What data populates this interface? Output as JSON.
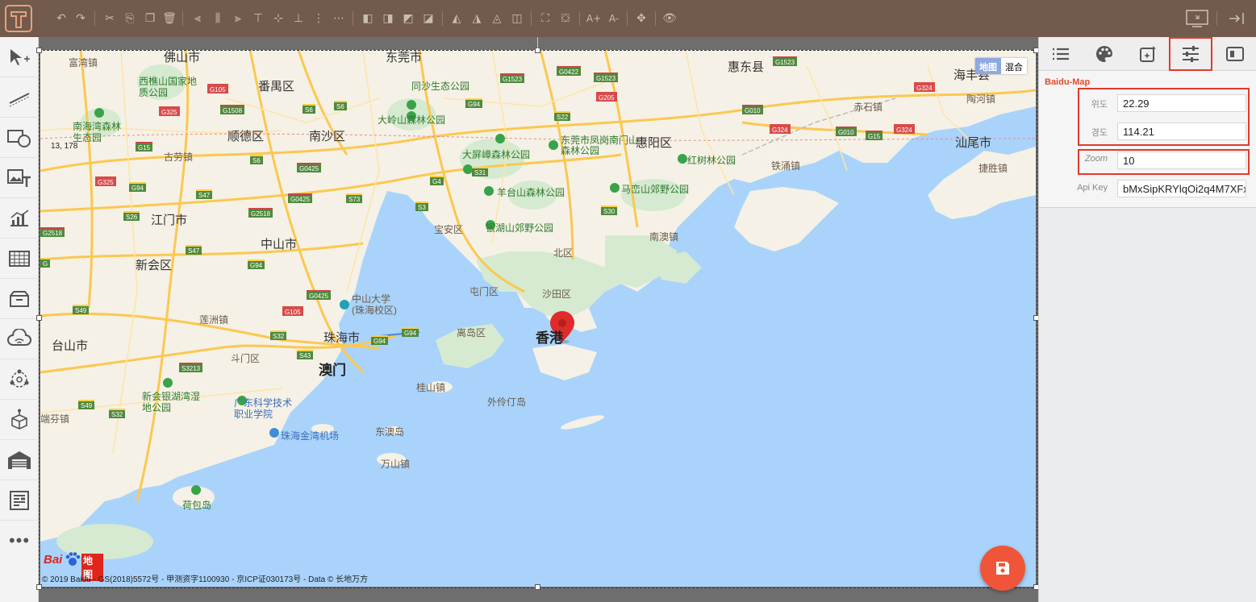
{
  "toolbar": {
    "logo": "T",
    "buttons": [
      "undo-icon",
      "redo-icon",
      "cut-icon",
      "copy-icon",
      "paste-icon",
      "delete-icon",
      "align-left-icon",
      "align-center-icon",
      "align-right-icon",
      "align-top-icon",
      "align-middle-icon",
      "align-bottom-icon",
      "distribute-h-icon",
      "distribute-v-icon",
      "bring-front-icon",
      "send-back-icon",
      "bring-forward-icon",
      "send-backward-icon",
      "flip-h-icon",
      "flip-v-icon",
      "rotate-left-icon",
      "rotate-right-icon",
      "group-icon",
      "ungroup-icon",
      "font-increase-icon",
      "font-decrease-icon",
      "move-icon",
      "preview-icon"
    ],
    "font_up": "A+",
    "font_down": "A-"
  },
  "leftbar": {
    "items": [
      "pointer-tool-icon",
      "line-tool-icon",
      "shape-tool-icon",
      "image-text-tool-icon",
      "chart-tool-icon",
      "table-tool-icon",
      "container-tool-icon",
      "cloud-wifi-tool-icon",
      "network-tool-icon",
      "3d-box-tool-icon",
      "warehouse-tool-icon",
      "form-tool-icon"
    ],
    "more_label": "•••"
  },
  "map": {
    "type_buttons": {
      "map": "地图",
      "hybrid": "混合"
    },
    "cursor_coords": "13, 178",
    "copyright": "© 2019 Baidu - GS(2018)5572号 - 甲测资字1100930 - 京ICP证030173号 - Data © 长地万方",
    "logo_text": "Bai",
    "logo_text2": "地图",
    "labels": {
      "foshan": "佛山市",
      "dongguan": "东莞市",
      "huidong": "惠东县",
      "haifeng": "海丰县",
      "fugang": "富湾镇",
      "xiqiao": "西樵山国家地质公园",
      "panyu": "番禺区",
      "tongsha": "同沙生态公园",
      "nanhaiwan": "南海湾森林生态园",
      "shunde": "顺德区",
      "nansha": "南沙区",
      "dalingshan": "大岭山森林公园",
      "dongguanfeng": "东莞市凤岗南门山森林公园",
      "huiyang": "惠阳区",
      "chishi": "赤石镇",
      "taohe": "陶河镇",
      "dapingzhang": "大屏嶂森林公园",
      "honshulin": "红树林公园",
      "shanwei": "汕尾市",
      "gulao": "古劳镇",
      "tiechang": "铁涌镇",
      "jieshen": "捷胜镇",
      "yangtaishan": "羊台山森林公园",
      "maluanshan": "马峦山郊野公园",
      "jiangmen": "江门市",
      "zhongshan": "中山市",
      "baoan": "宝安区",
      "yinhushan": "银湖山郊野公园",
      "nanao": "南澳镇",
      "xinhui": "新会区",
      "beiqu": "北区",
      "tunmen": "屯门区",
      "shatian": "沙田区",
      "sysu": "中山大学(珠海校区)",
      "lianzhou": "莲洲镇",
      "taishan": "台山市",
      "zhuhai": "珠海市",
      "lidao": "离岛区",
      "hongkong": "香港",
      "doumen": "斗门区",
      "macau": "澳门",
      "guishan": "桂山镇",
      "wailingding": "外伶仃岛",
      "xinhuiwetland": "新会银湖湾湿地公园",
      "gdst": "广东科学技术职业学院",
      "duanfen": "端芬镇",
      "dongao": "东澳岛",
      "airport": "珠海金湾机场",
      "wanshan": "万山镇",
      "hebao": "荷包岛"
    }
  },
  "panel": {
    "tabs": [
      "list-icon",
      "palette-icon",
      "magic-icon",
      "sliders-icon",
      "panel-toggle-icon"
    ],
    "section_title": "Baidu-Map",
    "fields": [
      {
        "label": "위도",
        "value": "22.29"
      },
      {
        "label": "경도",
        "value": "114.21"
      },
      {
        "label": "Zoom",
        "value": "10"
      },
      {
        "label": "Api Key",
        "value": "bMxSipKRYlqOi2q4M7XFx0SU"
      }
    ]
  },
  "save_button": "save-icon",
  "colors": {
    "accent": "#f0553a",
    "toolbar": "#725a4c",
    "highlight": "#e23a2a",
    "water": "#a9d3fb",
    "land": "#f5f1e6"
  }
}
